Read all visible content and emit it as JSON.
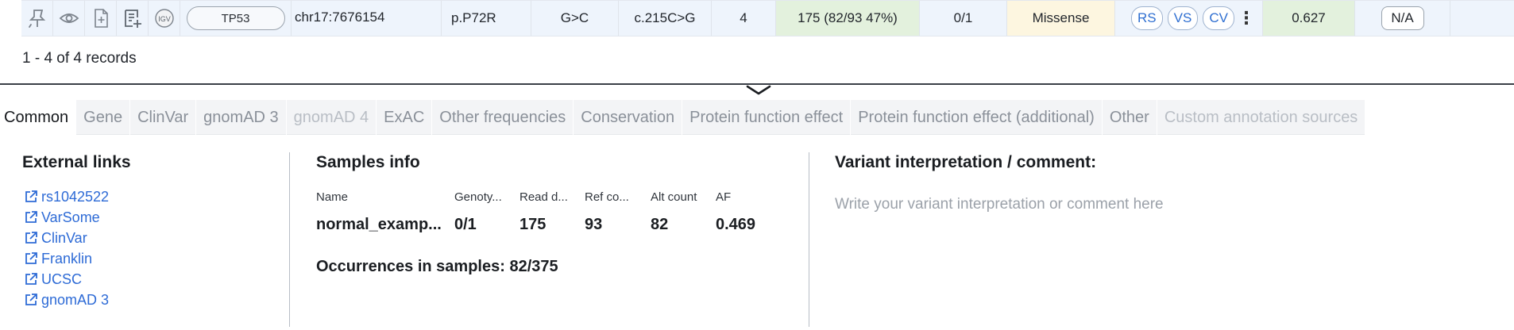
{
  "row": {
    "icons": [
      "pin-icon",
      "eye-icon",
      "add-document-icon",
      "add-list-icon",
      "igv-icon"
    ],
    "igv_label": "IGV",
    "gene": "TP53",
    "position": "chr17:7676154",
    "protein_change": "p.P72R",
    "ref_alt": "G>C",
    "cdna_change": "c.215C>G",
    "count": "4",
    "depth": "175  (82/93 47%)",
    "genotype": "0/1",
    "effect": "Missense",
    "link_buttons": [
      "RS",
      "VS",
      "CV"
    ],
    "score": "0.627",
    "na": "N/A",
    "colors": {
      "depth_bg": "#e3f1dd",
      "effect_bg": "#fdf6e0",
      "score_bg": "#e3f1dd",
      "link_blue": "#2f6fd1"
    }
  },
  "records_label": "1 - 4 of 4 records",
  "tabs": [
    {
      "label": "Common",
      "state": "active"
    },
    {
      "label": "Gene",
      "state": "normal"
    },
    {
      "label": "ClinVar",
      "state": "normal"
    },
    {
      "label": "gnomAD 3",
      "state": "normal"
    },
    {
      "label": "gnomAD 4",
      "state": "disabled"
    },
    {
      "label": "ExAC",
      "state": "normal"
    },
    {
      "label": "Other frequencies",
      "state": "normal"
    },
    {
      "label": "Conservation",
      "state": "normal"
    },
    {
      "label": "Protein function effect",
      "state": "normal"
    },
    {
      "label": "Protein function effect (additional)",
      "state": "normal"
    },
    {
      "label": "Other",
      "state": "normal"
    },
    {
      "label": "Custom annotation sources",
      "state": "disabled"
    }
  ],
  "external_links": {
    "title": "External links",
    "items": [
      "rs1042522",
      "VarSome",
      "ClinVar",
      "Franklin",
      "UCSC",
      "gnomAD 3"
    ]
  },
  "samples": {
    "title": "Samples info",
    "headers": [
      "Name",
      "Genoty...",
      "Read d...",
      "Ref co...",
      "Alt count",
      "AF"
    ],
    "rows": [
      [
        "normal_examp...",
        "0/1",
        "175",
        "93",
        "82",
        "0.469"
      ]
    ],
    "occurrences": "Occurrences in samples: 82/375"
  },
  "interpretation": {
    "title": "Variant interpretation / comment:",
    "placeholder": "Write your variant interpretation or comment here"
  }
}
